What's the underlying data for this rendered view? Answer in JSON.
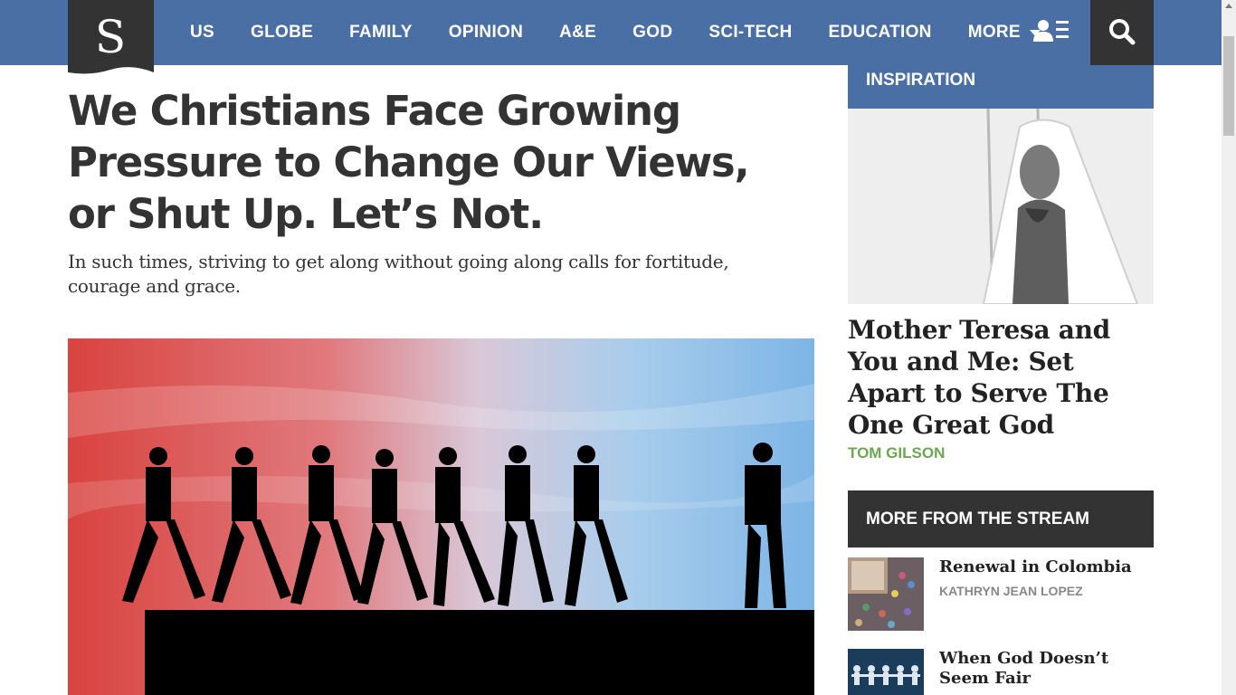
{
  "colors": {
    "nav_bg": "#4a6fa5",
    "search_bg": "#333333",
    "accent_green": "#6aa84f",
    "dark_head": "#333333"
  },
  "logo": {
    "letter": "S"
  },
  "nav": {
    "items": [
      "US",
      "GLOBE",
      "FAMILY",
      "OPINION",
      "A&E",
      "GOD",
      "SCI-TECH",
      "EDUCATION"
    ],
    "more_label": "MORE",
    "account_icon": "user-menu-icon",
    "search_icon": "search-icon"
  },
  "article": {
    "title": "We Christians Face Growing Pressure to Change Our Views, or Shut Up. Let’s Not.",
    "dek": "In such times, striving to get along without going along calls for fortitude, courage and grace."
  },
  "sidebar": {
    "inspiration": {
      "label": "INSPIRATION",
      "title": "Mother Teresa and You and Me: Set Apart to Serve The One Great God",
      "author": "TOM GILSON"
    },
    "stream": {
      "label": "MORE FROM THE STREAM",
      "items": [
        {
          "title": "Renewal in Colombia",
          "author": "KATHRYN JEAN LOPEZ"
        },
        {
          "title": "When God Doesn’t Seem Fair",
          "author": ""
        }
      ]
    }
  }
}
